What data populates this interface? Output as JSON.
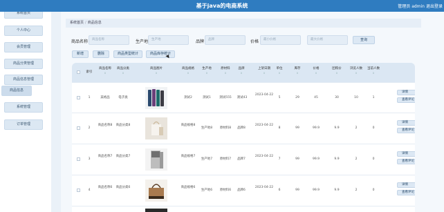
{
  "header": {
    "title": "基于java的电商系统",
    "user": "管理员 admin",
    "logout": "退出登录"
  },
  "sidebar": {
    "items": [
      "系统首页",
      "个人中心",
      "会员管理",
      "商品分类管理",
      "商品信息管理",
      "商品信息",
      "系统管理",
      "订单管理"
    ]
  },
  "breadcrumb": {
    "home": "系统首页",
    "sep": "/",
    "current": "商品信息"
  },
  "filters": {
    "name_label": "商品名称",
    "name_placeholder": "商品名称",
    "origin_label": "生产地",
    "origin_placeholder": "生产地",
    "brand_label": "品牌",
    "brand_placeholder": "品牌",
    "price_label": "价格",
    "price_min_placeholder": "最小价格",
    "price_max_placeholder": "最大价格",
    "search_label": "查询"
  },
  "actions": {
    "add": "新增",
    "delete": "删除",
    "stat_type": "商品类型统计",
    "stat_stock": "商品库存统计"
  },
  "table": {
    "headers": [
      "索引",
      "商品名称",
      "商品分类",
      "商品图片",
      "商品规格",
      "生产地",
      "原材料",
      "品牌",
      "上架日期",
      "单位",
      "库存",
      "价格",
      "团购价",
      "浏览人数",
      "当前人数"
    ],
    "rows": [
      {
        "index": "1",
        "name": "美格品",
        "category": "电子类",
        "spec": "测试2",
        "origin": "测试1",
        "material": "测试555",
        "brand": "测试43",
        "date": "2023-04-22",
        "unit": "5",
        "stock": "29",
        "price": "45",
        "group": "30",
        "views": "10",
        "current": "1"
      },
      {
        "index": "2",
        "name": "商品名称8",
        "category": "商品分类8",
        "spec": "商品规格8",
        "origin": "生产地8",
        "material": "原材料8",
        "brand": "品牌8",
        "date": "2023-04-22",
        "unit": "8",
        "stock": "99",
        "price": "99.9",
        "group": "9.9",
        "views": "2",
        "current": "0"
      },
      {
        "index": "3",
        "name": "商品名称7",
        "category": "商品分类7",
        "spec": "商品规格7",
        "origin": "生产地7",
        "material": "原材料7",
        "brand": "品牌7",
        "date": "2023-04-22",
        "unit": "7",
        "stock": "99",
        "price": "99.9",
        "group": "9.9",
        "views": "2",
        "current": "0"
      },
      {
        "index": "4",
        "name": "商品名称6",
        "category": "商品分类6",
        "spec": "商品规格6",
        "origin": "生产地6",
        "material": "原材料6",
        "brand": "品牌6",
        "date": "2023-04-22",
        "unit": "6",
        "stock": "99",
        "price": "99.9",
        "group": "9.9",
        "views": "2",
        "current": "0"
      }
    ],
    "row_actions": {
      "detail": "详情",
      "review": "查看评论"
    }
  }
}
